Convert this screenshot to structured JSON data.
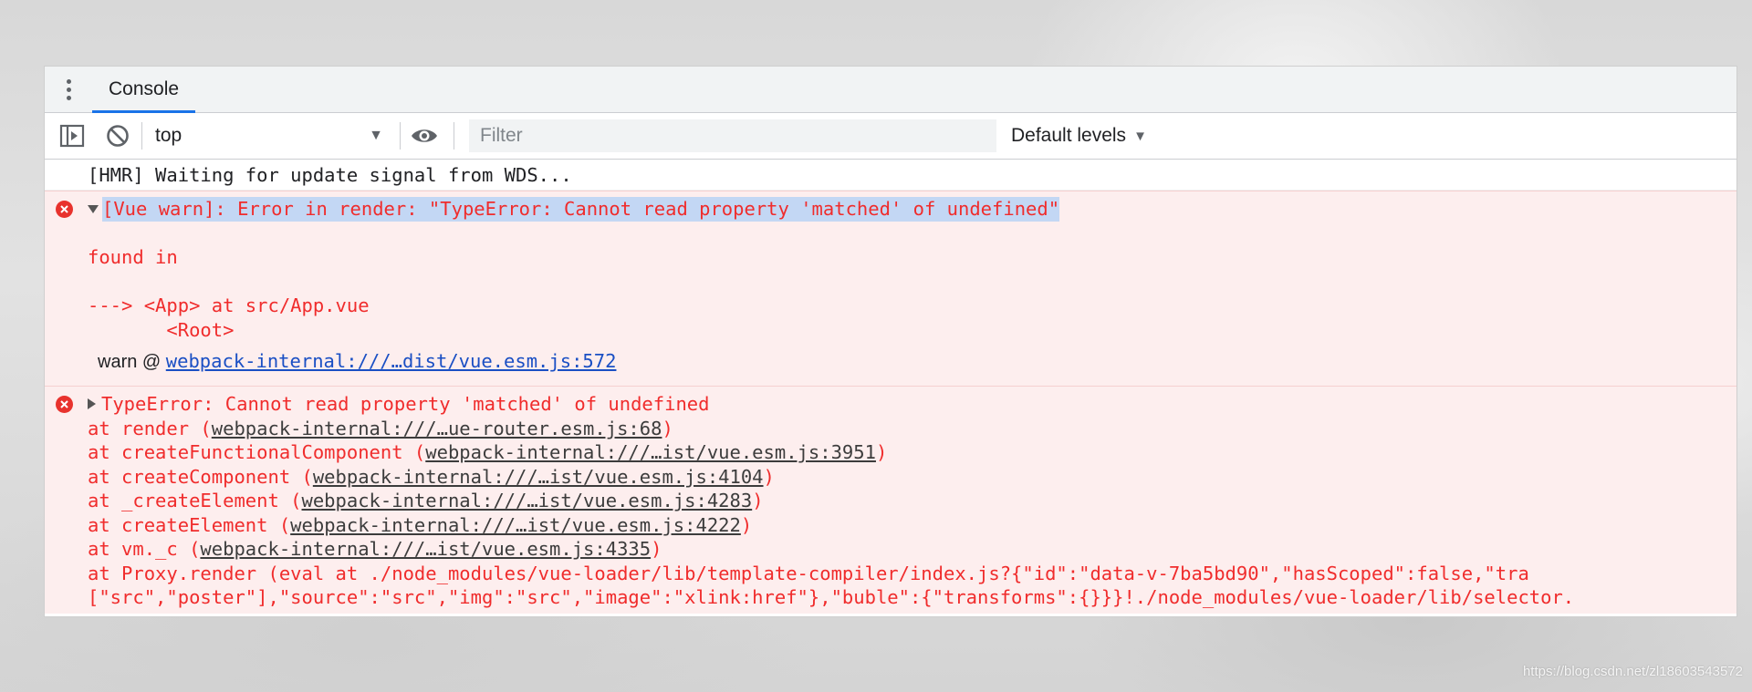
{
  "tabs": {
    "menu_icon": "kebab-menu-icon",
    "console_label": "Console"
  },
  "toolbar": {
    "sidebar_icon": "sidebar-toggle-icon",
    "clear_icon": "clear-console-icon",
    "context_value": "top",
    "eye_icon": "live-expression-eye-icon",
    "filter_placeholder": "Filter",
    "levels_label": "Default levels",
    "caret": "▼"
  },
  "messages": {
    "hmr": "[HMR] Waiting for update signal from WDS...",
    "warn": {
      "headline": "[Vue warn]: Error in render: \"TypeError: Cannot read property 'matched' of undefined\"",
      "found_in": "found in",
      "trace_1": "---> <App> at src/App.vue",
      "trace_2": "       <Root>",
      "source_prefix": "warn @ ",
      "source_link": "webpack-internal:///…dist/vue.esm.js:572"
    },
    "error": {
      "headline": "TypeError: Cannot read property 'matched' of undefined",
      "stack": [
        {
          "prefix": "at render (",
          "link": "webpack-internal:///…ue-router.esm.js:68",
          "suffix": ")"
        },
        {
          "prefix": "at createFunctionalComponent (",
          "link": "webpack-internal:///…ist/vue.esm.js:3951",
          "suffix": ")"
        },
        {
          "prefix": "at createComponent (",
          "link": "webpack-internal:///…ist/vue.esm.js:4104",
          "suffix": ")"
        },
        {
          "prefix": "at _createElement (",
          "link": "webpack-internal:///…ist/vue.esm.js:4283",
          "suffix": ")"
        },
        {
          "prefix": "at createElement (",
          "link": "webpack-internal:///…ist/vue.esm.js:4222",
          "suffix": ")"
        },
        {
          "prefix": "at vm._c (",
          "link": "webpack-internal:///…ist/vue.esm.js:4335",
          "suffix": ")"
        }
      ],
      "proxy_line": "at Proxy.render (eval at ./node_modules/vue-loader/lib/template-compiler/index.js?{\"id\":\"data-v-7ba5bd90\",\"hasScoped\":false,\"tra",
      "tail_line": "[\"src\",\"poster\"],\"source\":\"src\",\"img\":\"src\",\"image\":\"xlink:href\"},\"buble\":{\"transforms\":{}}}!./node_modules/vue-loader/lib/selector."
    }
  },
  "watermark": "https://blog.csdn.net/zl18603543572",
  "colors": {
    "error_text": "#f02c2c",
    "error_bg": "#fdeeee",
    "accent_tab": "#1a73e8",
    "link_blue": "#1a4fc4"
  }
}
